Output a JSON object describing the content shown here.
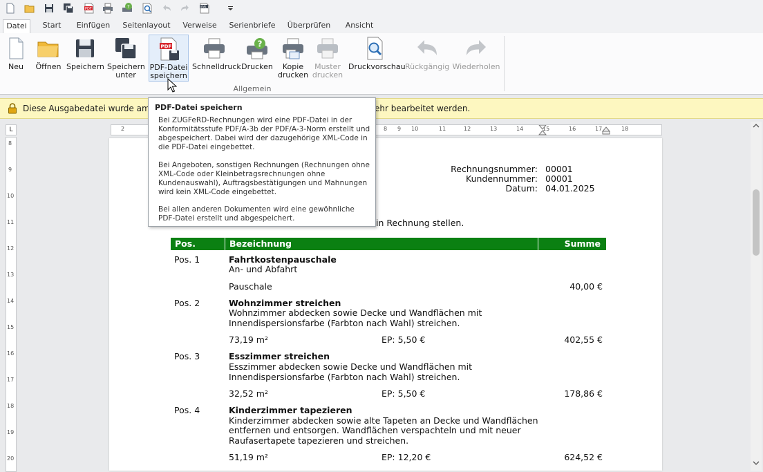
{
  "qat": {
    "icons": [
      "new-file-icon",
      "open-folder-icon",
      "save-icon",
      "save-as-icon",
      "pdf-icon",
      "print-icon",
      "print-help-icon",
      "print-preview-icon",
      "undo-icon",
      "redo-icon",
      "xml-icon",
      "customize-dropdown-icon"
    ]
  },
  "tabs": [
    "Datei",
    "Start",
    "Einfügen",
    "Seitenlayout",
    "Verweise",
    "Serienbriefe",
    "Überprüfen",
    "Ansicht"
  ],
  "ribbon": {
    "buttons": [
      {
        "line1": "Neu",
        "line2": ""
      },
      {
        "line1": "Öffnen",
        "line2": ""
      },
      {
        "line1": "Speichern",
        "line2": ""
      },
      {
        "line1": "Speichern",
        "line2": "unter"
      },
      {
        "line1": "PDF-Datei",
        "line2": "speichern"
      },
      {
        "line1": "Schnelldruck",
        "line2": ""
      },
      {
        "line1": "Drucken",
        "line2": ""
      },
      {
        "line1": "Kopie",
        "line2": "drucken"
      },
      {
        "line1": "Muster",
        "line2": "drucken"
      },
      {
        "line1": "Druckvorschau",
        "line2": ""
      },
      {
        "line1": "Rückgängig",
        "line2": ""
      },
      {
        "line1": "Wiederholen",
        "line2": ""
      }
    ],
    "group_label": "Allgemein"
  },
  "infobar": {
    "text_left": "Diese Ausgabedatei wurde am 04",
    "text_right": "ehr bearbeitet werden."
  },
  "rulers": {
    "h_left": [
      "2"
    ],
    "h_right": [
      "8",
      "9",
      "10",
      "11",
      "12",
      "13",
      "14",
      "15",
      "16",
      "17",
      "18"
    ],
    "v": [
      "8",
      "9",
      "10",
      "11",
      "12",
      "13",
      "14",
      "15",
      "16",
      "17",
      "18",
      "19",
      "20"
    ],
    "corner": "L"
  },
  "document": {
    "meta": [
      {
        "label": "Rechnungsnummer:",
        "value": "00001"
      },
      {
        "label": "Kundennummer:",
        "value": "00001"
      },
      {
        "label": "Datum:",
        "value": "04.01.2025"
      }
    ],
    "intro_tail": "in Rechnung stellen.",
    "table_header": {
      "pos": "Pos.",
      "desc": "Bezeichnung",
      "sum": "Summe"
    },
    "header_color": "#0b8012",
    "items": [
      {
        "pos": "Pos. 1",
        "title": "Fahrtkostenpauschale",
        "lines": [
          "An- und Abfahrt"
        ],
        "qty": "Pauschale",
        "ep": "",
        "sum": "40,00 €"
      },
      {
        "pos": "Pos. 2",
        "title": "Wohnzimmer streichen",
        "lines": [
          "Wohnzimmer abdecken sowie Decke und Wandflächen mit",
          "Innendispersionsfarbe (Farbton nach Wahl) streichen."
        ],
        "qty": "73,19 m²",
        "ep": "EP: 5,50 €",
        "sum": "402,55 €"
      },
      {
        "pos": "Pos. 3",
        "title": "Esszimmer streichen",
        "lines": [
          "Esszimmer abdecken sowie Decke und Wandflächen mit",
          "Innendispersionsfarbe (Farbton nach Wahl) streichen."
        ],
        "qty": "32,52 m²",
        "ep": "EP: 5,50 €",
        "sum": "178,86 €"
      },
      {
        "pos": "Pos. 4",
        "title": "Kinderzimmer tapezieren",
        "lines": [
          "Kinderzimmer abdecken sowie alte Tapeten an Decke und Wandflächen",
          "entfernen und entsorgen. Wandflächen verspachteln und mit neuer",
          "Raufasertapete tapezieren und streichen."
        ],
        "qty": "51,19 m²",
        "ep": "EP: 12,20 €",
        "sum": "624,52 €"
      }
    ]
  },
  "tooltip": {
    "title": "PDF-Datei speichern",
    "p1": "Bei ZUGFeRD-Rechnungen wird eine PDF-Datei in der Konformitätsstufe PDF/A-3b der PDF/A-3-Norm erstellt und abgespeichert. Dabei wird der dazugehörige XML-Code in die PDF-Datei eingebettet.",
    "p2": "Bei Angeboten, sonstigen Rechnungen (Rechnungen ohne XML-Code oder Kleinbetragsrechnungen ohne Kundenauswahl), Auftragsbestätigungen und Mahnungen wird kein XML-Code eingebettet.",
    "p3": "Bei allen anderen Dokumenten wird eine gewöhnliche PDF-Datei erstellt und abgespeichert."
  }
}
